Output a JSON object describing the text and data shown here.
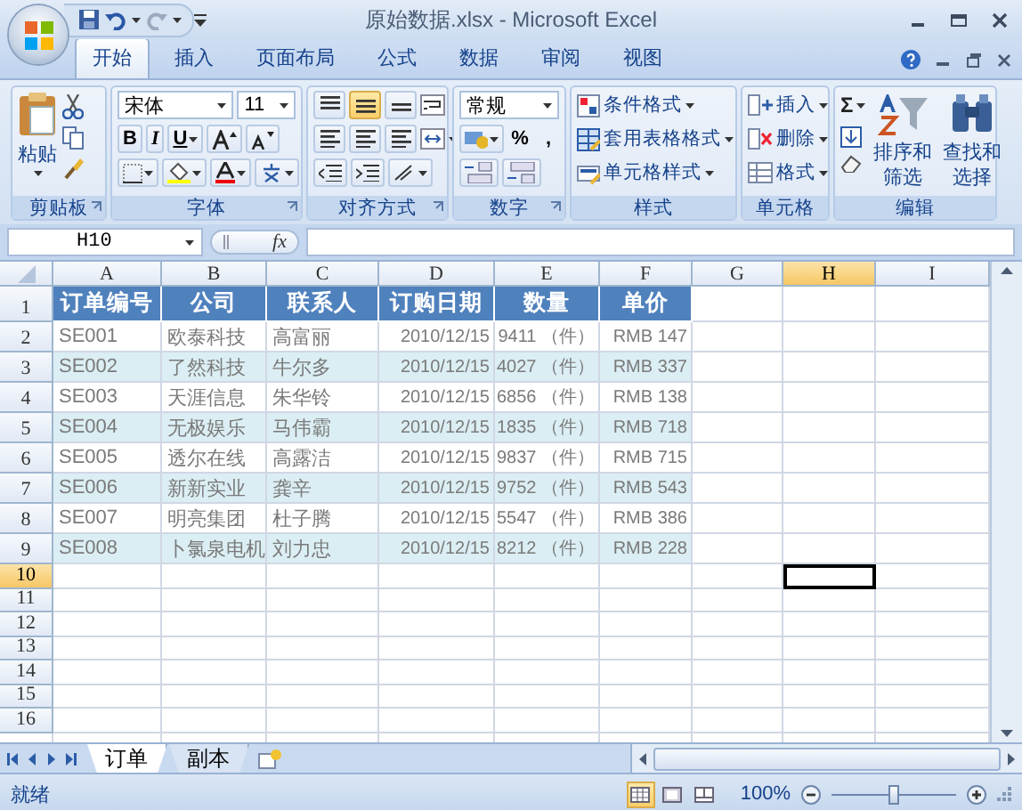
{
  "window": {
    "title": "原始数据.xlsx - Microsoft Excel"
  },
  "ribbon": {
    "tabs": [
      {
        "label": "开始",
        "selected": true
      },
      {
        "label": "插入",
        "selected": false
      },
      {
        "label": "页面布局",
        "selected": false
      },
      {
        "label": "公式",
        "selected": false
      },
      {
        "label": "数据",
        "selected": false
      },
      {
        "label": "审阅",
        "selected": false
      },
      {
        "label": "视图",
        "selected": false
      }
    ],
    "groups": [
      {
        "kind": "clipboard",
        "label": "剪贴板",
        "paste": "粘贴"
      },
      {
        "kind": "font",
        "label": "字体",
        "font_name": "宋体",
        "font_size": "11",
        "styles": [
          "B",
          "I",
          "U"
        ]
      },
      {
        "kind": "alignment",
        "label": "对齐方式",
        "vertical_align": [
          {
            "selected": false
          },
          {
            "selected": true
          },
          {
            "selected": false
          }
        ]
      },
      {
        "kind": "number",
        "label": "数字",
        "format": "常规",
        "symbols": [
          "%",
          ","
        ]
      },
      {
        "kind": "styles",
        "label": "样式",
        "items": [
          "条件格式",
          "套用表格格式",
          "单元格样式"
        ]
      },
      {
        "kind": "cells",
        "label": "单元格",
        "items": [
          "插入",
          "删除",
          "格式"
        ]
      },
      {
        "kind": "editing",
        "label": "编辑",
        "sum": "Σ",
        "items": [
          "排序和筛选",
          "查找和选择"
        ]
      }
    ]
  },
  "formula_bar": {
    "name_box": "H10",
    "function_label": "fx"
  },
  "sheet": {
    "columns": [
      {
        "label": "A",
        "selected": false
      },
      {
        "label": "B",
        "selected": false
      },
      {
        "label": "C",
        "selected": false
      },
      {
        "label": "D",
        "selected": false
      },
      {
        "label": "E",
        "selected": false
      },
      {
        "label": "F",
        "selected": false
      },
      {
        "label": "G",
        "selected": false
      },
      {
        "label": "H",
        "selected": true
      },
      {
        "label": "I",
        "selected": false
      }
    ],
    "row_numbers": [
      {
        "label": "1",
        "selected": false
      },
      {
        "label": "2",
        "selected": false
      },
      {
        "label": "3",
        "selected": false
      },
      {
        "label": "4",
        "selected": false
      },
      {
        "label": "5",
        "selected": false
      },
      {
        "label": "6",
        "selected": false
      },
      {
        "label": "7",
        "selected": false
      },
      {
        "label": "8",
        "selected": false
      },
      {
        "label": "9",
        "selected": false
      },
      {
        "label": "10",
        "selected": true
      },
      {
        "label": "11",
        "selected": false
      },
      {
        "label": "12",
        "selected": false
      },
      {
        "label": "13",
        "selected": false
      },
      {
        "label": "14",
        "selected": false
      },
      {
        "label": "15",
        "selected": false
      },
      {
        "label": "16",
        "selected": false
      }
    ],
    "header": [
      "订单编号",
      "公司",
      "联系人",
      "订购日期",
      "数量",
      "单价"
    ],
    "records": [
      [
        "SE001",
        "欧泰科技",
        "高富丽",
        "2010/12/15",
        "9411 （件）",
        "RMB 147"
      ],
      [
        "SE002",
        "了然科技",
        "牛尔多",
        "2010/12/15",
        "4027 （件）",
        "RMB 337"
      ],
      [
        "SE003",
        "天涯信息",
        "朱华铃",
        "2010/12/15",
        "6856 （件）",
        "RMB 138"
      ],
      [
        "SE004",
        "无极娱乐",
        "马伟霸",
        "2010/12/15",
        "1835 （件）",
        "RMB 718"
      ],
      [
        "SE005",
        "透尔在线",
        "高露洁",
        "2010/12/15",
        "9837 （件）",
        "RMB 715"
      ],
      [
        "SE006",
        "新新实业",
        "龚辛",
        "2010/12/15",
        "9752 （件）",
        "RMB 543"
      ],
      [
        "SE007",
        "明亮集团",
        "杜子腾",
        "2010/12/15",
        "5547 （件）",
        "RMB 386"
      ],
      [
        "SE008",
        "卜氯泉电机",
        "刘力忠",
        "2010/12/15",
        "8212 （件）",
        "RMB 228"
      ]
    ]
  },
  "sheet_tabs": [
    {
      "label": "订单",
      "selected": true
    },
    {
      "label": "副本",
      "selected": false
    }
  ],
  "status_bar": {
    "status": "就绪",
    "view_buttons": [
      {
        "selected": true
      },
      {
        "selected": false
      },
      {
        "selected": false
      }
    ],
    "zoom": {
      "reading": "100%",
      "level": 0.5
    }
  }
}
